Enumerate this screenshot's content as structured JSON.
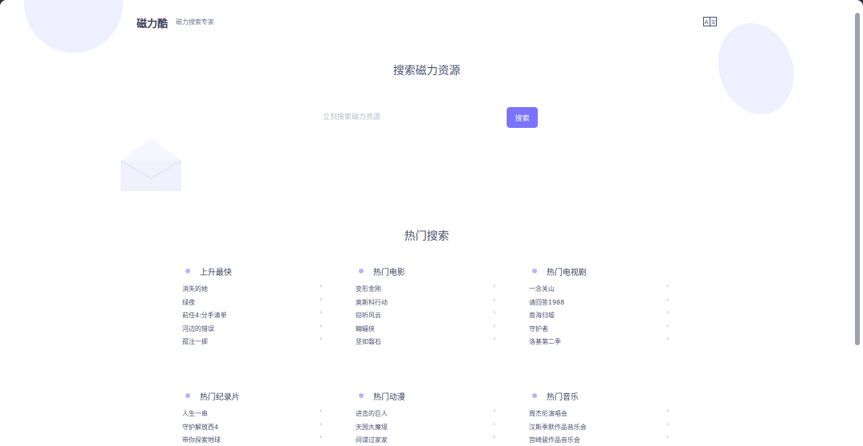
{
  "header": {
    "brand": "磁力酷",
    "tagline": "磁力搜索专家"
  },
  "hero": {
    "title": "搜索磁力资源",
    "search_placeholder": "立刻搜索磁力资源",
    "search_button": "搜索"
  },
  "hot": {
    "title": "热门搜索",
    "categories": [
      {
        "title": "上升最快",
        "items": [
          "消失的她",
          "绿夜",
          "前任4:分手清单",
          "河边的错误",
          "孤注一掷"
        ]
      },
      {
        "title": "热门电影",
        "items": [
          "变形金刚",
          "奥斯科行动",
          "窃听风云",
          "蝙蝠侠",
          "坚如磐石"
        ]
      },
      {
        "title": "热门电视剧",
        "items": [
          "一念关山",
          "请回答1988",
          "南海归墟",
          "守护者",
          "洛基第二季"
        ]
      },
      {
        "title": "热门纪录片",
        "items": [
          "人生一串",
          "守护解放西4",
          "带你探索地球"
        ]
      },
      {
        "title": "热门动漫",
        "items": [
          "进击的巨人",
          "天国大魔境",
          "间谍过家家"
        ]
      },
      {
        "title": "热门音乐",
        "items": [
          "周杰伦演唱会",
          "汉斯季默作品音乐会",
          "宫崎骏作品音乐会"
        ]
      }
    ]
  },
  "icons": {
    "translate": "translate-icon",
    "arrow": "chevron-right-icon",
    "bullet": "dot-icon"
  },
  "colors": {
    "accent": "#7b73ff",
    "decoration": "#eef0ff",
    "text": "#4a4f6e"
  }
}
